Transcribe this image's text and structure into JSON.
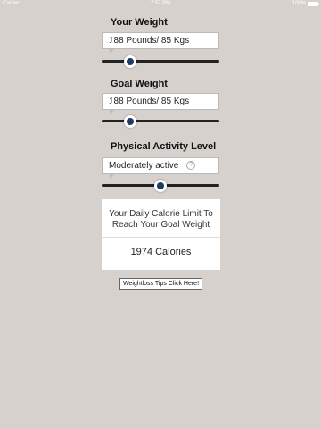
{
  "status_bar": {
    "carrier": "Carrier",
    "time": "7:57 PM",
    "battery": "100%",
    "battery_level": 1.0
  },
  "weight": {
    "title": "Your Weight",
    "value": "188 Pounds/ 85 Kgs",
    "slider_fraction": 0.24
  },
  "goal_weight": {
    "title": "Goal Weight",
    "value": "188 Pounds/ 85 Kgs",
    "slider_fraction": 0.24
  },
  "activity": {
    "title": "Physical Activity Level",
    "value": "Moderately active",
    "help_icon_glyph": "?",
    "slider_fraction": 0.5
  },
  "result": {
    "line1": "Your Daily Calorie Limit To",
    "line2": "Reach Your Goal Weight",
    "calories": "1974 Calories"
  },
  "tips_button": {
    "label": "Weightloss Tips Click Here!"
  },
  "colors": {
    "background": "#d6d1cc",
    "slider_thumb": "#1f3a63",
    "track": "#222222"
  }
}
